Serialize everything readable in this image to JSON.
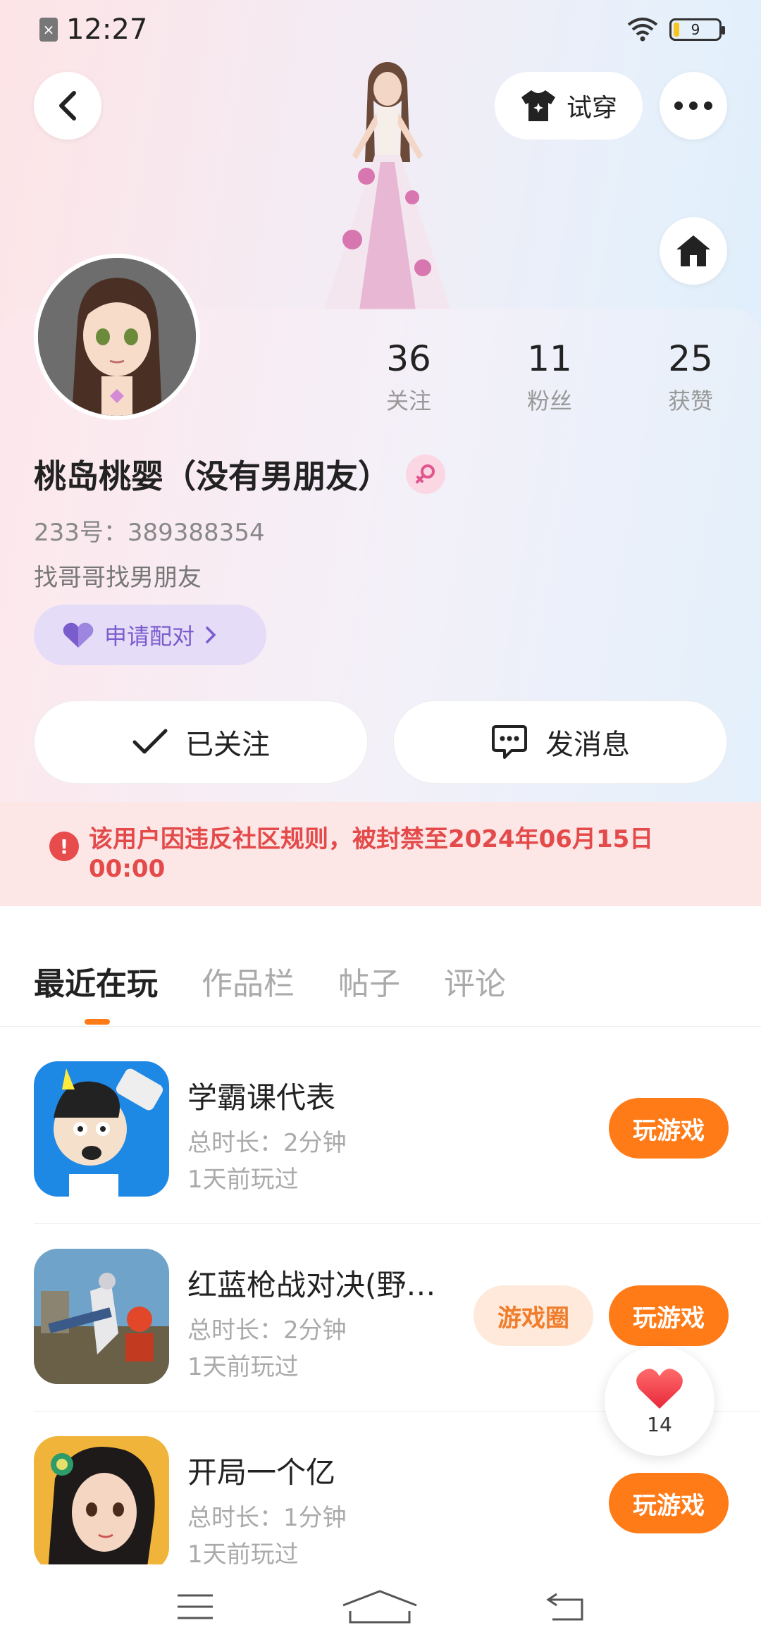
{
  "status_bar": {
    "time": "12:27",
    "battery": "9"
  },
  "header": {
    "try_on_label": "试穿"
  },
  "stats": [
    {
      "value": "36",
      "label": "关注"
    },
    {
      "value": "11",
      "label": "粉丝"
    },
    {
      "value": "25",
      "label": "获赞"
    }
  ],
  "profile": {
    "name": "桃岛桃婴（没有男朋友）",
    "id_line": "233号：389388354",
    "bio": "找哥哥找男朋友",
    "pair_label": "申请配对"
  },
  "actions": {
    "follow_label": "已关注",
    "message_label": "发消息"
  },
  "ban_notice": "该用户因违反社区规则，被封禁至2024年06月15日00:00",
  "tabs": [
    "最近在玩",
    "作品栏",
    "帖子",
    "评论"
  ],
  "games": [
    {
      "title": "学霸课代表",
      "duration": "总时长：2分钟",
      "last_played": "1天前玩过",
      "play_label": "玩游戏"
    },
    {
      "title": "红蓝枪战对决(野…",
      "duration": "总时长：2分钟",
      "last_played": "1天前玩过",
      "play_label": "玩游戏",
      "circle_label": "游戏圈"
    },
    {
      "title": "开局一个亿",
      "duration": "总时长：1分钟",
      "last_played": "1天前玩过",
      "play_label": "玩游戏"
    }
  ],
  "like_count": "14",
  "colors": {
    "accent": "#ff7b18",
    "ban_text": "#e44a4a",
    "pair_purple": "#7a5ccd"
  }
}
